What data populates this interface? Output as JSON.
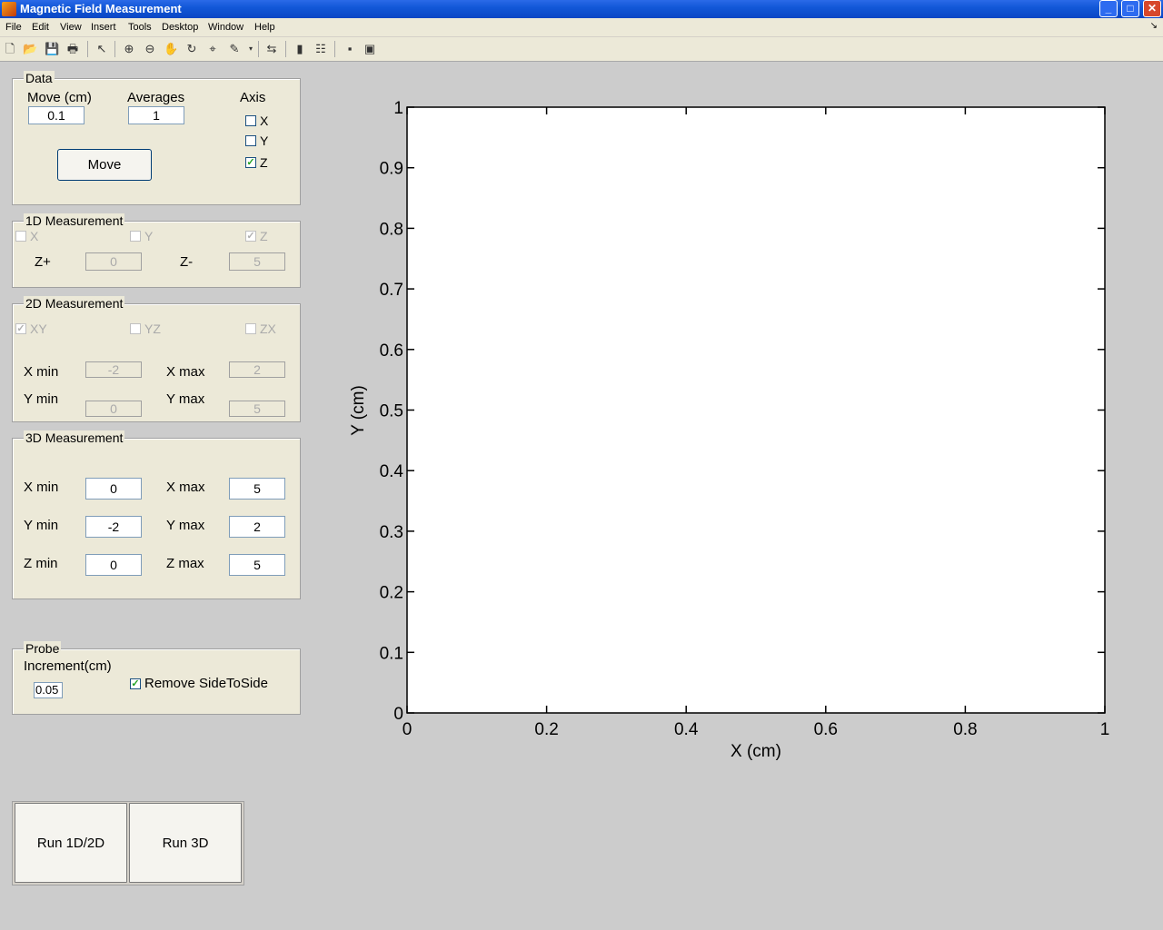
{
  "window": {
    "title": "Magnetic Field Measurement"
  },
  "menu": [
    "File",
    "Edit",
    "View",
    "Insert",
    "Tools",
    "Desktop",
    "Window",
    "Help"
  ],
  "toolbar_icons": [
    "new-file-icon",
    "open-file-icon",
    "save-icon",
    "print-icon",
    "pointer-icon",
    "zoom-in-icon",
    "zoom-out-icon",
    "pan-icon",
    "rotate-icon",
    "data-cursor-icon",
    "brush-icon",
    "link-plot-icon",
    "colorbar-icon",
    "legend-icon",
    "hide-tools-icon",
    "show-tools-icon"
  ],
  "data_panel": {
    "title": "Data",
    "move_label": "Move (cm)",
    "move_value": "0.1",
    "averages_label": "Averages",
    "averages_value": "1",
    "axis_label": "Axis",
    "axis_x": "X",
    "axis_y": "Y",
    "axis_z": "Z",
    "axis_x_checked": false,
    "axis_y_checked": false,
    "axis_z_checked": true,
    "move_button": "Move"
  },
  "m1d": {
    "title": "1D Measurement",
    "x": "X",
    "y": "Y",
    "z": "Z",
    "zplus_label": "Z+",
    "zplus_value": "0",
    "zminus_label": "Z-",
    "zminus_value": "5"
  },
  "m2d": {
    "title": "2D Measurement",
    "xy": "XY",
    "yz": "YZ",
    "zx": "ZX",
    "xmin_label": "X min",
    "xmin_value": "-2",
    "xmax_label": "X max",
    "xmax_value": "2",
    "ymin_label": "Y min",
    "ymin_value": "0",
    "ymax_label": "Y max",
    "ymax_value": "5"
  },
  "m3d": {
    "title": "3D Measurement",
    "xmin_label": "X min",
    "xmin_value": "0",
    "xmax_label": "X max",
    "xmax_value": "5",
    "ymin_label": "Y min",
    "ymin_value": "-2",
    "ymax_label": "Y max",
    "ymax_value": "2",
    "zmin_label": "Z min",
    "zmin_value": "0",
    "zmax_label": "Z max",
    "zmax_value": "5"
  },
  "probe": {
    "title": "Probe",
    "increment_label": "Increment(cm)",
    "increment_value": "0.05",
    "remove_label": "Remove SideToSide",
    "remove_checked": true
  },
  "run_1d2d": "Run 1D/2D",
  "run_3d": "Run 3D",
  "chart_data": {
    "type": "line",
    "series": [],
    "xlabel": "X (cm)",
    "ylabel": "Y (cm)",
    "xlim": [
      0,
      1
    ],
    "ylim": [
      0,
      1
    ],
    "xticks": [
      0,
      0.2,
      0.4,
      0.6,
      0.8,
      1
    ],
    "yticks": [
      0,
      0.1,
      0.2,
      0.3,
      0.4,
      0.5,
      0.6,
      0.7,
      0.8,
      0.9,
      1
    ],
    "xtick_labels": [
      "0",
      "0.2",
      "0.4",
      "0.6",
      "0.8",
      "1"
    ],
    "ytick_labels": [
      "0",
      "0.1",
      "0.2",
      "0.3",
      "0.4",
      "0.5",
      "0.6",
      "0.7",
      "0.8",
      "0.9",
      "1"
    ],
    "grid": false
  }
}
